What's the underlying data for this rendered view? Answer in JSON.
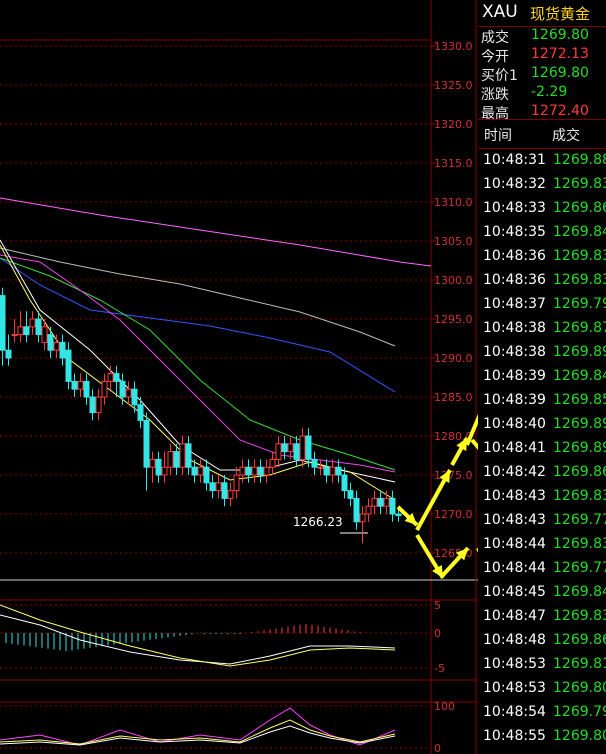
{
  "instrument": {
    "symbol": "XAU",
    "name": "现货黄金"
  },
  "quote": [
    {
      "label": "成交",
      "value": "1269.80",
      "color": "green"
    },
    {
      "label": "今开",
      "value": "1272.13",
      "color": "red"
    },
    {
      "label": "买价1",
      "value": "1269.80",
      "color": "green"
    },
    {
      "label": "涨跌",
      "value": "-2.29",
      "color": "green"
    },
    {
      "label": "最高",
      "value": "1272.40",
      "color": "red"
    }
  ],
  "ticks_header": {
    "time": "时间",
    "deal": "成交"
  },
  "ticks": [
    {
      "time": "10:48:31",
      "price": "1269.88"
    },
    {
      "time": "10:48:32",
      "price": "1269.83"
    },
    {
      "time": "10:48:33",
      "price": "1269.86"
    },
    {
      "time": "10:48:35",
      "price": "1269.84"
    },
    {
      "time": "10:48:36",
      "price": "1269.83"
    },
    {
      "time": "10:48:36",
      "price": "1269.83"
    },
    {
      "time": "10:48:37",
      "price": "1269.79"
    },
    {
      "time": "10:48:38",
      "price": "1269.87"
    },
    {
      "time": "10:48:38",
      "price": "1269.89"
    },
    {
      "time": "10:48:39",
      "price": "1269.84"
    },
    {
      "time": "10:48:39",
      "price": "1269.85"
    },
    {
      "time": "10:48:40",
      "price": "1269.89"
    },
    {
      "time": "10:48:41",
      "price": "1269.89"
    },
    {
      "time": "10:48:42",
      "price": "1269.86"
    },
    {
      "time": "10:48:43",
      "price": "1269.83"
    },
    {
      "time": "10:48:43",
      "price": "1269.77"
    },
    {
      "time": "10:48:44",
      "price": "1269.83"
    },
    {
      "time": "10:48:44",
      "price": "1269.77"
    },
    {
      "time": "10:48:45",
      "price": "1269.84"
    },
    {
      "time": "10:48:47",
      "price": "1269.83"
    },
    {
      "time": "10:48:48",
      "price": "1269.86"
    },
    {
      "time": "10:48:53",
      "price": "1269.81"
    },
    {
      "time": "10:48:53",
      "price": "1269.80"
    },
    {
      "time": "10:48:54",
      "price": "1269.79"
    },
    {
      "time": "10:48:55",
      "price": "1269.80"
    }
  ],
  "price_axis": [
    "1330.0",
    "1325.0",
    "1320.0",
    "1315.0",
    "1310.0",
    "1305.0",
    "1300.0",
    "1295.0",
    "1290.0",
    "1285.0",
    "1280.0",
    "1275.0",
    "1270.0",
    "1265.0"
  ],
  "macd_axis": [
    "5",
    "0",
    "-5"
  ],
  "kdj_axis": [
    "100",
    "0"
  ],
  "annotation": "1266.23",
  "colors": {
    "up": "#ff3c3c",
    "down": "#33e6e6",
    "grid": "#8a0000",
    "axis_text": "#d23030"
  }
}
